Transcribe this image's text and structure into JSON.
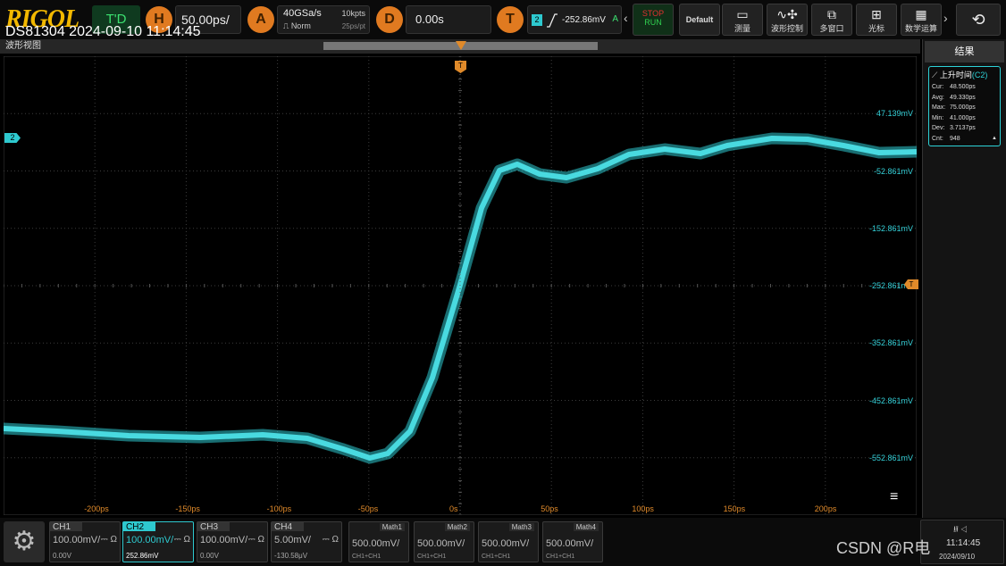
{
  "brand": "RIGOL",
  "top": {
    "trigger_mode": "T'D",
    "horizontal": {
      "badge": "H",
      "value": "50.00ps/"
    },
    "acquire": {
      "badge": "A",
      "sample_rate": "40GSa/s",
      "mode": "Norm",
      "depth": "10kpts",
      "per_point": "25ps/pt"
    },
    "delay": {
      "badge": "D",
      "value": "0.00s"
    },
    "trigger": {
      "badge": "T",
      "channel": "2",
      "level": "-252.86mV",
      "coupling": "A"
    },
    "buttons": {
      "stop_run_1": "STOP",
      "stop_run_2": "RUN",
      "default": "Default",
      "measure": "测量",
      "wave_ctrl": "波形控制",
      "multiwin": "多窗口",
      "cursor": "光标",
      "math": "数学运算"
    },
    "stamp": "DS81304 2024-09-10 11:14:45"
  },
  "window_title": "波形视图",
  "scope": {
    "channel_marker": "2",
    "trigger_marker": "T",
    "y_labels": [
      "47.139mV",
      "-52.861mV",
      "-152.861mV",
      "-252.861mV",
      "-352.861mV",
      "-452.861mV",
      "-552.861mV"
    ],
    "x_labels": [
      "-200ps",
      "-150ps",
      "-100ps",
      "-50ps",
      "0s",
      "50ps",
      "100ps",
      "150ps",
      "200ps"
    ],
    "trace_color": "#2ec9cf",
    "menu_icon": "≡"
  },
  "results": {
    "header": "结果",
    "measurement": {
      "title": "上升时间",
      "source": "C2",
      "rows": [
        {
          "k": "Cur:",
          "v": "48.500ps"
        },
        {
          "k": "Avg:",
          "v": "49.330ps"
        },
        {
          "k": "Max:",
          "v": "75.000ps"
        },
        {
          "k": "Min:",
          "v": "41.000ps"
        },
        {
          "k": "Dev:",
          "v": "3.7137ps"
        },
        {
          "k": "Cnt:",
          "v": "948"
        }
      ]
    }
  },
  "channels": [
    {
      "name": "CH1",
      "scale": "100.00mV/",
      "offset": "0.00V",
      "color": "#e8e000"
    },
    {
      "name": "CH2",
      "scale": "100.00mV/",
      "offset": "252.86mV",
      "color": "#2ec9cf"
    },
    {
      "name": "CH3",
      "scale": "100.00mV/",
      "offset": "0.00V",
      "color": "#d040d0"
    },
    {
      "name": "CH4",
      "scale": "5.00mV/",
      "offset": "-130.58μV",
      "color": "#2070f0"
    }
  ],
  "maths": [
    {
      "name": "Math1",
      "scale": "500.00mV/",
      "src": "CH1+CH1"
    },
    {
      "name": "Math2",
      "scale": "500.00mV/",
      "src": "CH1+CH1"
    },
    {
      "name": "Math3",
      "scale": "500.00mV/",
      "src": "CH1+CH1"
    },
    {
      "name": "Math4",
      "scale": "500.00mV/",
      "src": "CH1+CH1"
    }
  ],
  "status": {
    "time": "11:14:45",
    "date": "2024/09/10"
  },
  "watermark": "CSDN @R电"
}
